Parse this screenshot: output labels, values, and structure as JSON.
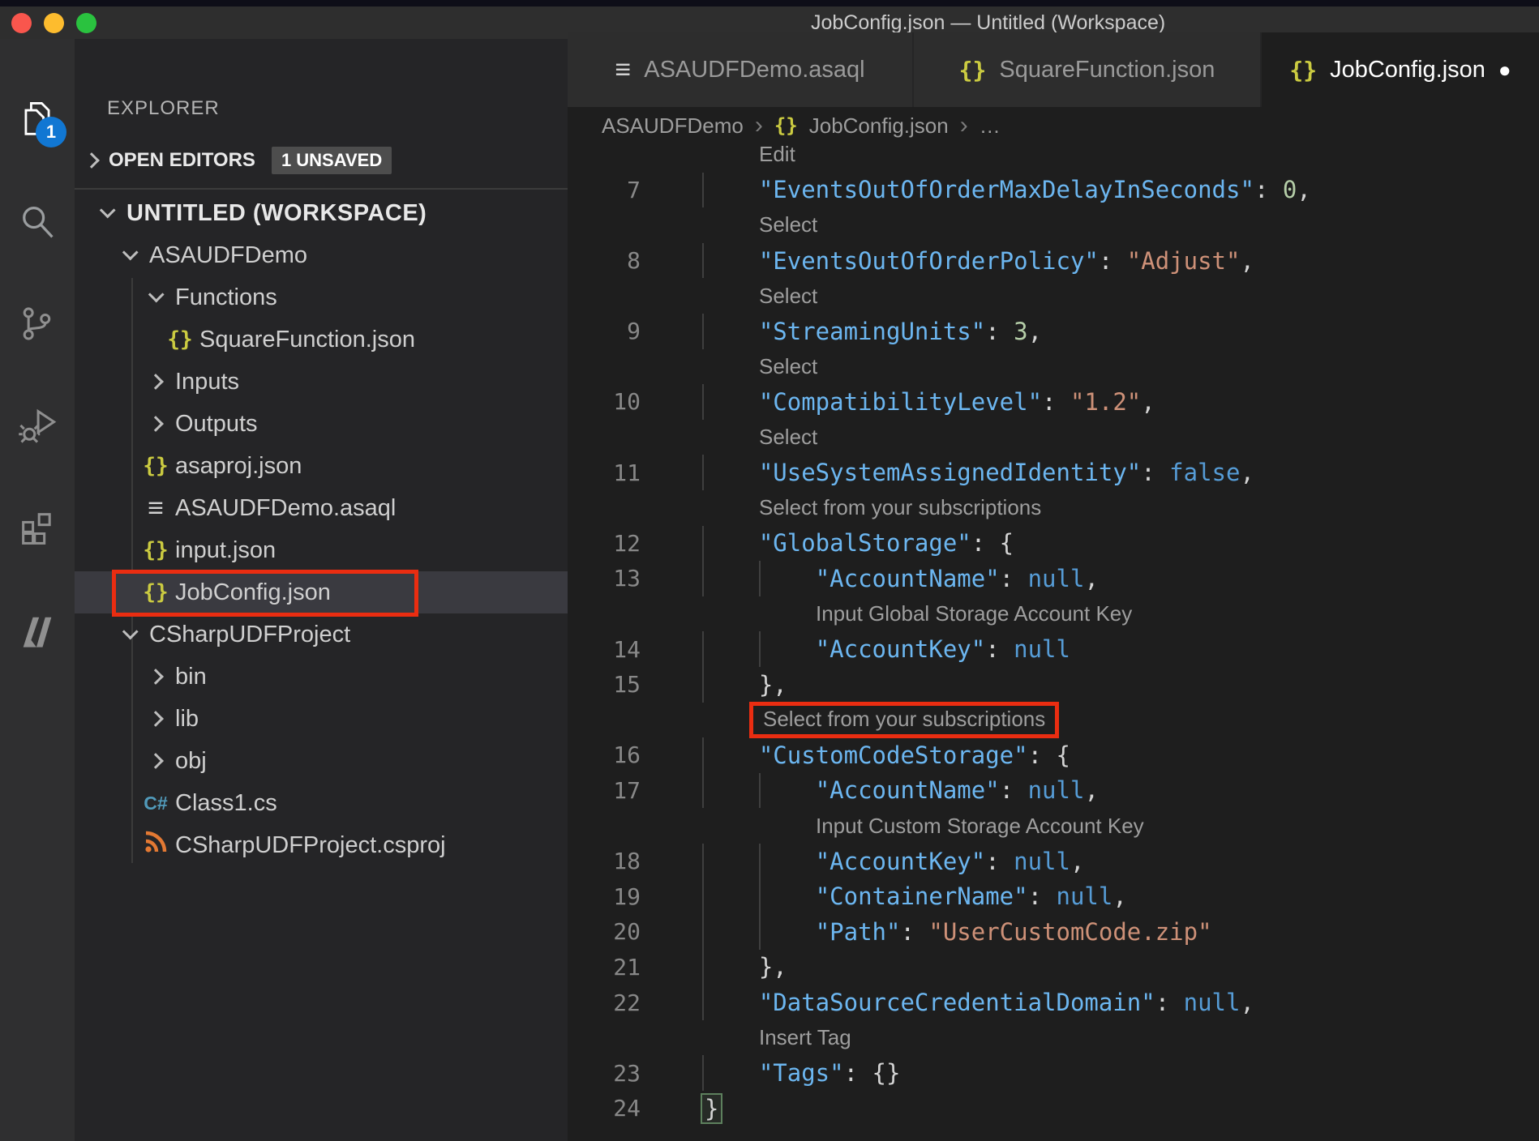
{
  "window": {
    "title": "JobConfig.json — Untitled (Workspace)"
  },
  "activity_bar": {
    "items": [
      {
        "name": "explorer",
        "active": true,
        "badge": "1"
      },
      {
        "name": "search"
      },
      {
        "name": "source-control"
      },
      {
        "name": "run-debug"
      },
      {
        "name": "extensions"
      },
      {
        "name": "azure"
      }
    ]
  },
  "sidebar": {
    "title": "EXPLORER",
    "open_editors": {
      "label": "OPEN EDITORS",
      "badge": "1 UNSAVED"
    },
    "tree": [
      {
        "label": "UNTITLED (WORKSPACE)",
        "depth": 0,
        "chevron": "down",
        "bold": true
      },
      {
        "label": "ASAUDFDemo",
        "depth": 1,
        "chevron": "down"
      },
      {
        "label": "Functions",
        "depth": 2,
        "chevron": "down"
      },
      {
        "label": "SquareFunction.json",
        "depth": 3,
        "icon": "json"
      },
      {
        "label": "Inputs",
        "depth": 2,
        "chevron": "right"
      },
      {
        "label": "Outputs",
        "depth": 2,
        "chevron": "right"
      },
      {
        "label": "asaproj.json",
        "depth": 2,
        "icon": "json"
      },
      {
        "label": "ASAUDFDemo.asaql",
        "depth": 2,
        "icon": "list"
      },
      {
        "label": "input.json",
        "depth": 2,
        "icon": "json"
      },
      {
        "label": "JobConfig.json",
        "depth": 2,
        "icon": "json",
        "selected": true,
        "annotated": true
      },
      {
        "label": "CSharpUDFProject",
        "depth": 1,
        "chevron": "down"
      },
      {
        "label": "bin",
        "depth": 2,
        "chevron": "right"
      },
      {
        "label": "lib",
        "depth": 2,
        "chevron": "right"
      },
      {
        "label": "obj",
        "depth": 2,
        "chevron": "right"
      },
      {
        "label": "Class1.cs",
        "depth": 2,
        "icon": "csharp"
      },
      {
        "label": "CSharpUDFProject.csproj",
        "depth": 2,
        "icon": "rss"
      }
    ]
  },
  "tabs": [
    {
      "label": "ASAUDFDemo.asaql",
      "icon": "list",
      "active": false,
      "dirty": false
    },
    {
      "label": "SquareFunction.json",
      "icon": "json",
      "active": false,
      "dirty": false
    },
    {
      "label": "JobConfig.json",
      "icon": "json",
      "active": true,
      "dirty": true
    }
  ],
  "breadcrumb": [
    {
      "label": "ASAUDFDemo"
    },
    {
      "label": "JobConfig.json",
      "icon": "json"
    },
    {
      "label": "…"
    }
  ],
  "editor": {
    "rows": [
      {
        "t": "lens",
        "col": 1,
        "text": "Edit"
      },
      {
        "t": "code",
        "num": "7",
        "g": 1,
        "seg": [
          [
            "pl",
            "    "
          ],
          [
            "k",
            "\"EventsOutOfOrderMaxDelayInSeconds\""
          ],
          [
            "p",
            ": "
          ],
          [
            "n",
            "0"
          ],
          [
            "p",
            ","
          ]
        ]
      },
      {
        "t": "lens",
        "col": 1,
        "text": "Select"
      },
      {
        "t": "code",
        "num": "8",
        "g": 1,
        "seg": [
          [
            "pl",
            "    "
          ],
          [
            "k",
            "\"EventsOutOfOrderPolicy\""
          ],
          [
            "p",
            ": "
          ],
          [
            "s",
            "\"Adjust\""
          ],
          [
            "p",
            ","
          ]
        ]
      },
      {
        "t": "lens",
        "col": 1,
        "text": "Select"
      },
      {
        "t": "code",
        "num": "9",
        "g": 1,
        "seg": [
          [
            "pl",
            "    "
          ],
          [
            "k",
            "\"StreamingUnits\""
          ],
          [
            "p",
            ": "
          ],
          [
            "n",
            "3"
          ],
          [
            "p",
            ","
          ]
        ]
      },
      {
        "t": "lens",
        "col": 1,
        "text": "Select"
      },
      {
        "t": "code",
        "num": "10",
        "g": 1,
        "seg": [
          [
            "pl",
            "    "
          ],
          [
            "k",
            "\"CompatibilityLevel\""
          ],
          [
            "p",
            ": "
          ],
          [
            "s",
            "\"1.2\""
          ],
          [
            "p",
            ","
          ]
        ]
      },
      {
        "t": "lens",
        "col": 1,
        "text": "Select"
      },
      {
        "t": "code",
        "num": "11",
        "g": 1,
        "seg": [
          [
            "pl",
            "    "
          ],
          [
            "k",
            "\"UseSystemAssignedIdentity\""
          ],
          [
            "p",
            ": "
          ],
          [
            "b",
            "false"
          ],
          [
            "p",
            ","
          ]
        ]
      },
      {
        "t": "lens",
        "col": 1,
        "text": "Select from your subscriptions"
      },
      {
        "t": "code",
        "num": "12",
        "g": 1,
        "seg": [
          [
            "pl",
            "    "
          ],
          [
            "k",
            "\"GlobalStorage\""
          ],
          [
            "p",
            ": {"
          ]
        ]
      },
      {
        "t": "code",
        "num": "13",
        "g": 2,
        "seg": [
          [
            "pl",
            "        "
          ],
          [
            "k",
            "\"AccountName\""
          ],
          [
            "p",
            ": "
          ],
          [
            "b",
            "null"
          ],
          [
            "p",
            ","
          ]
        ]
      },
      {
        "t": "lens",
        "col": 2,
        "text": "Input Global Storage Account Key"
      },
      {
        "t": "code",
        "num": "14",
        "g": 2,
        "seg": [
          [
            "pl",
            "        "
          ],
          [
            "k",
            "\"AccountKey\""
          ],
          [
            "p",
            ": "
          ],
          [
            "b",
            "null"
          ]
        ]
      },
      {
        "t": "code",
        "num": "15",
        "g": 1,
        "seg": [
          [
            "pl",
            "    "
          ],
          [
            "p",
            "},"
          ]
        ]
      },
      {
        "t": "lens",
        "col": 1,
        "text": "Select from your subscriptions",
        "red": true
      },
      {
        "t": "code",
        "num": "16",
        "g": 1,
        "seg": [
          [
            "pl",
            "    "
          ],
          [
            "k",
            "\"CustomCodeStorage\""
          ],
          [
            "p",
            ": {"
          ]
        ]
      },
      {
        "t": "code",
        "num": "17",
        "g": 2,
        "seg": [
          [
            "pl",
            "        "
          ],
          [
            "k",
            "\"AccountName\""
          ],
          [
            "p",
            ": "
          ],
          [
            "b",
            "null"
          ],
          [
            "p",
            ","
          ]
        ]
      },
      {
        "t": "lens",
        "col": 2,
        "text": "Input Custom Storage Account Key"
      },
      {
        "t": "code",
        "num": "18",
        "g": 2,
        "seg": [
          [
            "pl",
            "        "
          ],
          [
            "k",
            "\"AccountKey\""
          ],
          [
            "p",
            ": "
          ],
          [
            "b",
            "null"
          ],
          [
            "p",
            ","
          ]
        ]
      },
      {
        "t": "code",
        "num": "19",
        "g": 2,
        "seg": [
          [
            "pl",
            "        "
          ],
          [
            "k",
            "\"ContainerName\""
          ],
          [
            "p",
            ": "
          ],
          [
            "b",
            "null"
          ],
          [
            "p",
            ","
          ]
        ]
      },
      {
        "t": "code",
        "num": "20",
        "g": 2,
        "seg": [
          [
            "pl",
            "        "
          ],
          [
            "k",
            "\"Path\""
          ],
          [
            "p",
            ": "
          ],
          [
            "s",
            "\"UserCustomCode.zip\""
          ]
        ]
      },
      {
        "t": "code",
        "num": "21",
        "g": 1,
        "seg": [
          [
            "pl",
            "    "
          ],
          [
            "p",
            "},"
          ]
        ]
      },
      {
        "t": "code",
        "num": "22",
        "g": 1,
        "seg": [
          [
            "pl",
            "    "
          ],
          [
            "k",
            "\"DataSourceCredentialDomain\""
          ],
          [
            "p",
            ": "
          ],
          [
            "b",
            "null"
          ],
          [
            "p",
            ","
          ]
        ]
      },
      {
        "t": "lens",
        "col": 1,
        "text": "Insert Tag"
      },
      {
        "t": "code",
        "num": "23",
        "g": 1,
        "seg": [
          [
            "pl",
            "    "
          ],
          [
            "k",
            "\"Tags\""
          ],
          [
            "p",
            ": {}"
          ]
        ]
      },
      {
        "t": "code",
        "num": "24",
        "g": 0,
        "seg": [
          [
            "br",
            "}"
          ]
        ]
      }
    ]
  },
  "colors": {
    "annotation_red": "#ea2d11",
    "badge_blue": "#1177d3",
    "json_icon_yellow": "#cbcb41",
    "csharp_blue": "#519aba",
    "csproj_orange": "#e37933",
    "key_blue": "#6cb6f0",
    "string_orange": "#ce9178",
    "number_green": "#b5cea8",
    "keyword_blue": "#569cd6",
    "traffic_red": "#f9564d",
    "traffic_yellow": "#fdbc2e",
    "traffic_green": "#2ac23f"
  }
}
